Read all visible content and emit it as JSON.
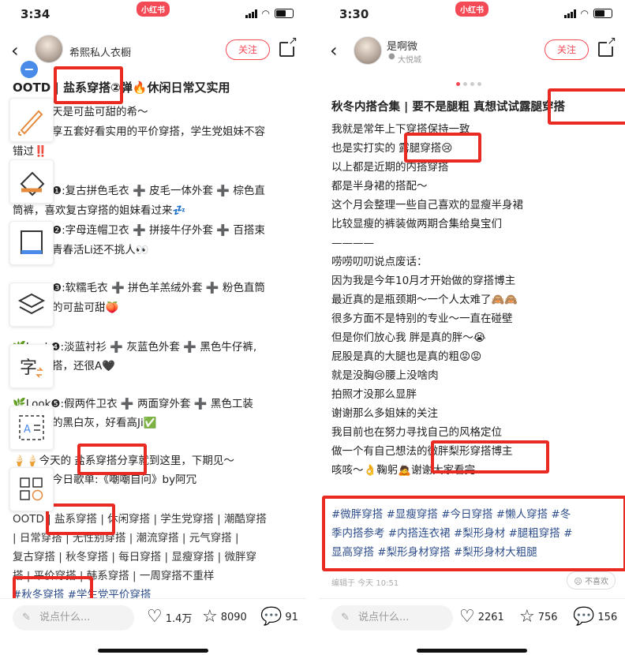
{
  "brand": "小红书",
  "left": {
    "time": "3:34",
    "username": "希熙私人衣橱",
    "follow": "关注",
    "title": "OOTD | 盐系穿搭②弹🔥休闲日常又实用",
    "lines": [
      "天是可盐可甜的希～",
      "享五套好看实用的平价穿搭，学生党姐妹不容",
      "错过‼️",
      "❶:复古拼色毛衣 ➕ 皮毛一体外套 ➕ 棕色直",
      "筒裤，喜欢复古穿搭的姐妹看过来💤",
      "❷:字母连帽卫衣 ➕ 拼接牛仔外套 ➕ 百搭束",
      "青春活Li还不挑人👀",
      "❸:软糯毛衣 ➕ 拼色羊羔绒外套 ➕ 粉色直筒",
      "的可盐可甜🍑",
      "🌿Look❹:淡蓝衬衫 ➕ 灰蓝色外套 ➕ 黑色牛仔裤,",
      "搭，还很A🖤",
      "🌿Look❺:假两件卫衣 ➕ 两面穿外套 ➕ 黑色工装",
      "的黑白灰，好看高Ji✅",
      "🍦🍦今天的 盐系穿搭分享就到这里，下期见〜",
      "今日歌单:《嘲嘲自问》by阿冗"
    ],
    "tags": [
      "OOTD | 盐系穿搭 | 休闲穿搭 | 学生党穿搭 | 潮酷穿搭",
      "| 日常穿搭 | 无性别穿搭 | 潮流穿搭 | 元气穿搭 |",
      "复古穿搭 | 秋冬穿搭 | 每日穿搭 | 显瘦穿搭 | 微胖穿",
      "搭 | 平价穿搭 | 韩系穿搭 | 一周穿搭不重样",
      "#秋冬穿搭  #学生党平价穿搭"
    ],
    "comment_placeholder": "说点什么...",
    "likes": "1.4万",
    "favorites": "8090",
    "comments": "91"
  },
  "right": {
    "time": "3:30",
    "username": "是啊微",
    "location": "大悦城",
    "follow": "关注",
    "title": "秋冬内搭合集 | 要不是腿粗 真想试试露腿穿搭",
    "lines": [
      "我就是常年上下穿搭保持一致",
      "也是实打实的 露腿穿搭😢",
      "以上都是近期的内搭穿搭",
      "都是半身裙的搭配～",
      "这个月会整理一些自己喜欢的显瘦半身裙",
      "比较显瘦的裤装做两期合集给臭宝们",
      "————",
      "唠唠叨叨说点废话：",
      "因为我是今年10月才开始做的穿搭博主",
      "最近真的是瓶颈期～一个人太难了🙈🙈",
      "很多方面不是特别的专业～一直在碰壁",
      "但是你们放心我 胖是真的胖～😭",
      "屁股是真的大腿也是真的粗😡😡",
      "就是没胸😢腰上没啥肉",
      "拍照才没那么显胖",
      "谢谢那么多姐妹的关注",
      "我目前也在努力寻找自己的风格定位",
      "做一个有自己想法的微胖梨形穿搭博主",
      "咳咳～👌鞠躬🙇谢谢大家看完"
    ],
    "tags": [
      "#微胖穿搭  #显瘦穿搭  #今日穿搭  #懒人穿搭  #冬",
      "季内搭参考  #内搭连衣裙  #梨形身材  #腿粗穿搭  #",
      "显高穿搭  #梨形身材穿搭  #梨形身材大粗腿"
    ],
    "edited": "编辑于 今天 10:51",
    "dislike": "不喜欢",
    "comment_placeholder": "说点什么...",
    "likes": "2261",
    "favorites": "756",
    "comments": "156"
  },
  "tool_icons": [
    "brush-icon",
    "eraser-icon",
    "frame-icon",
    "layers-icon",
    "translate-icon",
    "ocr-icon",
    "apps-icon"
  ],
  "colors": {
    "brand_red": "#f34a55",
    "annotation_red": "#e82a22",
    "tag_blue": "#2d4d8a",
    "tool_blue": "#4a8ae8"
  }
}
